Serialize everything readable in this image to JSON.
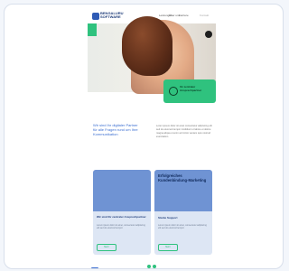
{
  "header": {
    "logo_text": "BENGALURU SOFTWARE",
    "nav": [
      "Leistungen",
      "Über uns",
      "Karriere",
      "Kontakt"
    ]
  },
  "hero": {
    "cta_label": "Ihr zentraler Ansprechpartner",
    "mic_icon": "microphone-icon"
  },
  "intro": {
    "title": "Wir sind Ihr digitaler Partner für alle Fragen rund um Ihre Kommunikation",
    "text": "Lorem ipsum dolor sit amet consectetur adipiscing elit sed do eiusmod tempor incididunt ut labore et dolore magna aliqua ut enim ad minim veniam quis nostrud exercitation"
  },
  "cards": [
    {
      "title": "Wir sind Ihr zentraler Ansprechpartner",
      "body": "Lorem ipsum dolor sit amet, consectetur adipiscing elit sed do eiusmod tempor.",
      "button": "Mehr"
    },
    {
      "big": "Erfolgreiches Kundenbindung-Marketing",
      "title": "Starke Support",
      "body": "Lorem ipsum dolor sit amet, consectetur adipiscing elit sed do eiusmod tempor.",
      "button": "Mehr"
    }
  ],
  "colors": {
    "accent_green": "#2fc27e",
    "brand_blue": "#3c6fd1",
    "card_blue": "#6f93d3"
  }
}
